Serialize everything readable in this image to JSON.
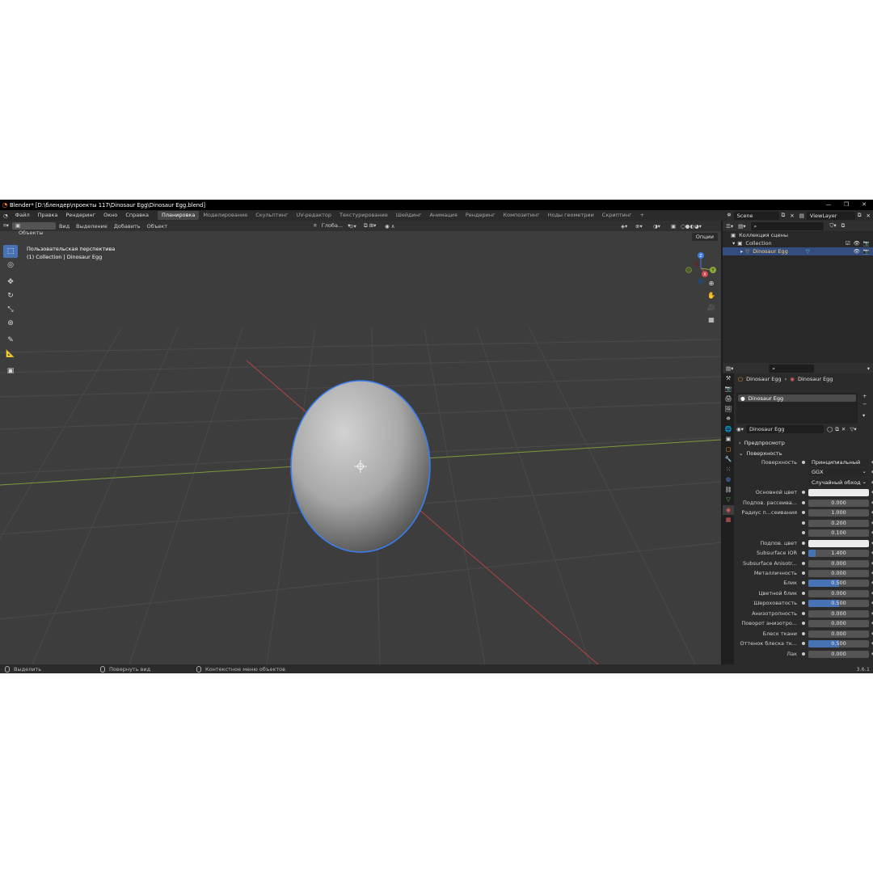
{
  "title_bar": {
    "title": "Blender* [D:\\блендер\\проекты 117\\Dinosaur Egg\\Dinosaur Egg.blend]",
    "minimize": "—",
    "maximize": "❐",
    "close": "✕"
  },
  "menu": [
    "Файл",
    "Правка",
    "Рендеринг",
    "Окно",
    "Справка"
  ],
  "workspaces": [
    "Планировка",
    "Моделирование",
    "Скульптинг",
    "UV-редактор",
    "Текстурирование",
    "Шейдинг",
    "Анимация",
    "Рендеринг",
    "Композитинг",
    "Ноды геометрии",
    "Скриптинг",
    "+"
  ],
  "active_workspace": "Планировка",
  "scene": "Scene",
  "view_layer": "ViewLayer",
  "viewport_header": {
    "mode": "Объекты",
    "menus": [
      "Вид",
      "Выделение",
      "Добавить",
      "Объект"
    ],
    "orientation": "Глоба..."
  },
  "viewport": {
    "perspective": "Пользовательская перспектива",
    "context": "(1) Collection | Dinosaur Egg",
    "options": "Опции",
    "gizmo": {
      "z": "Z",
      "y": "Y",
      "x": "X"
    }
  },
  "status_bar": {
    "select": "Выделить",
    "rotate": "Повернуть вид",
    "context_menu": "Контекстное меню объектов",
    "version": "3.6.1"
  },
  "outliner": {
    "scene_collection": "Коллекция сцены",
    "collection": "Collection",
    "object": "Dinosaur Egg"
  },
  "properties": {
    "breadcrumb_object": "Dinosaur Egg",
    "breadcrumb_material": "Dinosaur Egg",
    "slot": "Dinosaur Egg",
    "material": "Dinosaur Egg",
    "preview": "Предпросмотр",
    "surface": "Поверхность",
    "rows": [
      {
        "label": "Поверхность",
        "value": "Принципиальный BSDF",
        "kind": "dark"
      },
      {
        "label": "",
        "value": "GGX",
        "kind": "dark"
      },
      {
        "label": "",
        "value": "Случайный обход",
        "kind": "dark"
      },
      {
        "label": "Основной цвет",
        "value": "",
        "kind": "color"
      },
      {
        "label": "Подпов. рассеива...",
        "value": "0.000",
        "fill": 0
      },
      {
        "label": "Радиус п...сеивания",
        "value": "1.000",
        "fill": 0
      },
      {
        "label": "",
        "value": "0.200",
        "fill": 0
      },
      {
        "label": "",
        "value": "0.100",
        "fill": 0
      },
      {
        "label": "Подпов. цвет",
        "value": "",
        "kind": "color"
      },
      {
        "label": "Subsurface IOR",
        "value": "1.400",
        "fill": 0.12
      },
      {
        "label": "Subsurface Anisotr...",
        "value": "0.000",
        "fill": 0
      },
      {
        "label": "Металличность",
        "value": "0.000",
        "fill": 0
      },
      {
        "label": "Блик",
        "value": "0.500",
        "fill": 0.5
      },
      {
        "label": "Цветной блик",
        "value": "0.000",
        "fill": 0
      },
      {
        "label": "Шероховатость",
        "value": "0.500",
        "fill": 0.5
      },
      {
        "label": "Анизотропность",
        "value": "0.000",
        "fill": 0
      },
      {
        "label": "Поворот анизотро...",
        "value": "0.000",
        "fill": 0
      },
      {
        "label": "Блеск ткани",
        "value": "0.000",
        "fill": 0
      },
      {
        "label": "Оттенок блеска тк...",
        "value": "0.500",
        "fill": 0.5
      },
      {
        "label": "Лак",
        "value": "0.000",
        "fill": 0
      }
    ]
  },
  "colors": {
    "accent": "#4772b3",
    "selection_outline": "#3a7ff0",
    "x_axis": "#c94a4a",
    "y_axis": "#8aab3a"
  }
}
